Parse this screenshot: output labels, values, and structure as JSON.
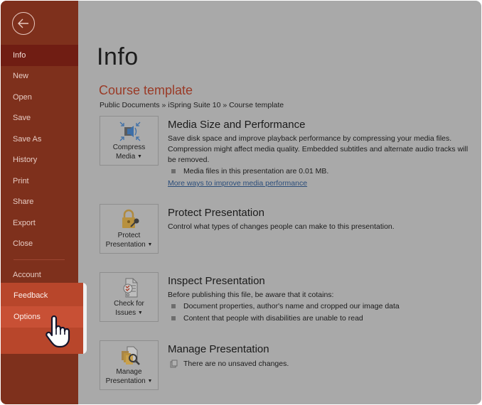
{
  "sidebar": {
    "back_icon": "back-arrow-icon",
    "items": [
      {
        "label": "Info",
        "active": true
      },
      {
        "label": "New"
      },
      {
        "label": "Open"
      },
      {
        "label": "Save"
      },
      {
        "label": "Save As"
      },
      {
        "label": "History"
      },
      {
        "label": "Print"
      },
      {
        "label": "Share"
      },
      {
        "label": "Export"
      },
      {
        "label": "Close"
      },
      {
        "label": "Account"
      },
      {
        "label": "Feedback"
      },
      {
        "label": "Options",
        "hovered": true
      }
    ]
  },
  "main": {
    "page_title": "Info",
    "file_title": "Course template",
    "breadcrumb": "Public Documents » iSpring Suite 10 » Course template",
    "sections": [
      {
        "button": {
          "line1": "Compress",
          "line2": "Media",
          "icon": "compress-media-icon"
        },
        "title": "Media Size and Performance",
        "description": "Save disk space and improve playback performance by compressing your media files. Compression might affect media quality. Embedded subtitles and alternate audio tracks will be removed.",
        "bullets": [
          "Media files in this presentation are 0.01 MB."
        ],
        "link": "More ways to improve media performance"
      },
      {
        "button": {
          "line1": "Protect",
          "line2": "Presentation",
          "icon": "lock-key-icon"
        },
        "title": "Protect Presentation",
        "description": "Control what types of changes people can make to this presentation."
      },
      {
        "button": {
          "line1": "Check for",
          "line2": "Issues",
          "icon": "check-document-icon"
        },
        "title": "Inspect Presentation",
        "description": "Before publishing this file, be aware that it cotains:",
        "bullets": [
          "Document properties, author's name and cropped our image data",
          "Content that people with disabilities are unable to read"
        ]
      },
      {
        "button": {
          "line1": "Manage",
          "line2": "Presentation",
          "icon": "manage-documents-icon"
        },
        "title": "Manage Presentation",
        "status": "There are no unsaved changes."
      }
    ]
  },
  "colors": {
    "sidebar_bg": "#7e301c",
    "sidebar_active": "#701d13",
    "highlight_bg": "#b8462b",
    "highlight_hover": "#c85035",
    "accent_title": "#9a3a26",
    "overlay_bg": "#a9a9a9"
  }
}
